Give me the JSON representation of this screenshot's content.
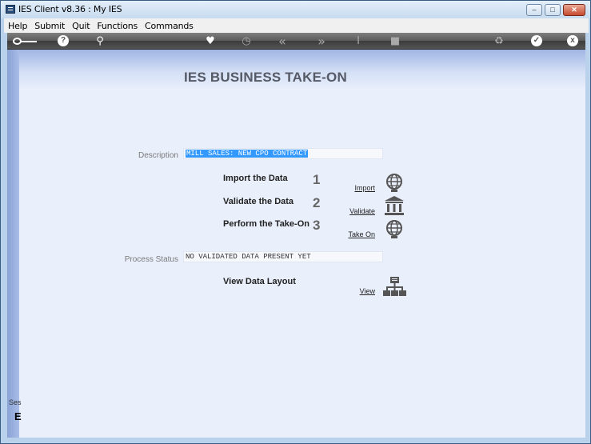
{
  "window": {
    "title": "IES Client v8.36 : My IES",
    "controls": [
      "minimize-icon",
      "maximize-icon",
      "close-icon"
    ]
  },
  "menu": {
    "items": [
      "Help",
      "Submit",
      "Quit",
      "Functions",
      "Commands"
    ]
  },
  "toolbar": {
    "icons": [
      "key-icon",
      "help-icon",
      "search-icon",
      "heart-icon",
      "clock-icon",
      "rewind-icon",
      "forward-icon",
      "text-cursor-icon",
      "stop-icon",
      "recycle-icon",
      "check-icon",
      "close-icon"
    ],
    "help_glyph": "?",
    "close_glyph": "x"
  },
  "page": {
    "title": "IES BUSINESS TAKE-ON"
  },
  "description": {
    "label": "Description",
    "value": "MILL SALES: NEW CPO CONTRACT"
  },
  "steps": [
    {
      "label": "Import the Data",
      "number": "1",
      "action": "Import",
      "icon": "globe-icon"
    },
    {
      "label": "Validate the Data",
      "number": "2",
      "action": "Validate",
      "icon": "bank-icon"
    },
    {
      "label": "Perform the Take-On",
      "number": "3",
      "action": "Take On",
      "icon": "globe-icon"
    }
  ],
  "process_status": {
    "label": "Process Status",
    "value": "NO VALIDATED DATA PRESENT YET"
  },
  "layout": {
    "label": "View Data Layout",
    "action": "View",
    "icon": "hierarchy-icon"
  },
  "session": {
    "label": "Ses",
    "glyph": "E"
  },
  "colors": {
    "selection": "#3399ff",
    "toolbar": "#4a4a4a",
    "content_bg": "#e9effb"
  }
}
